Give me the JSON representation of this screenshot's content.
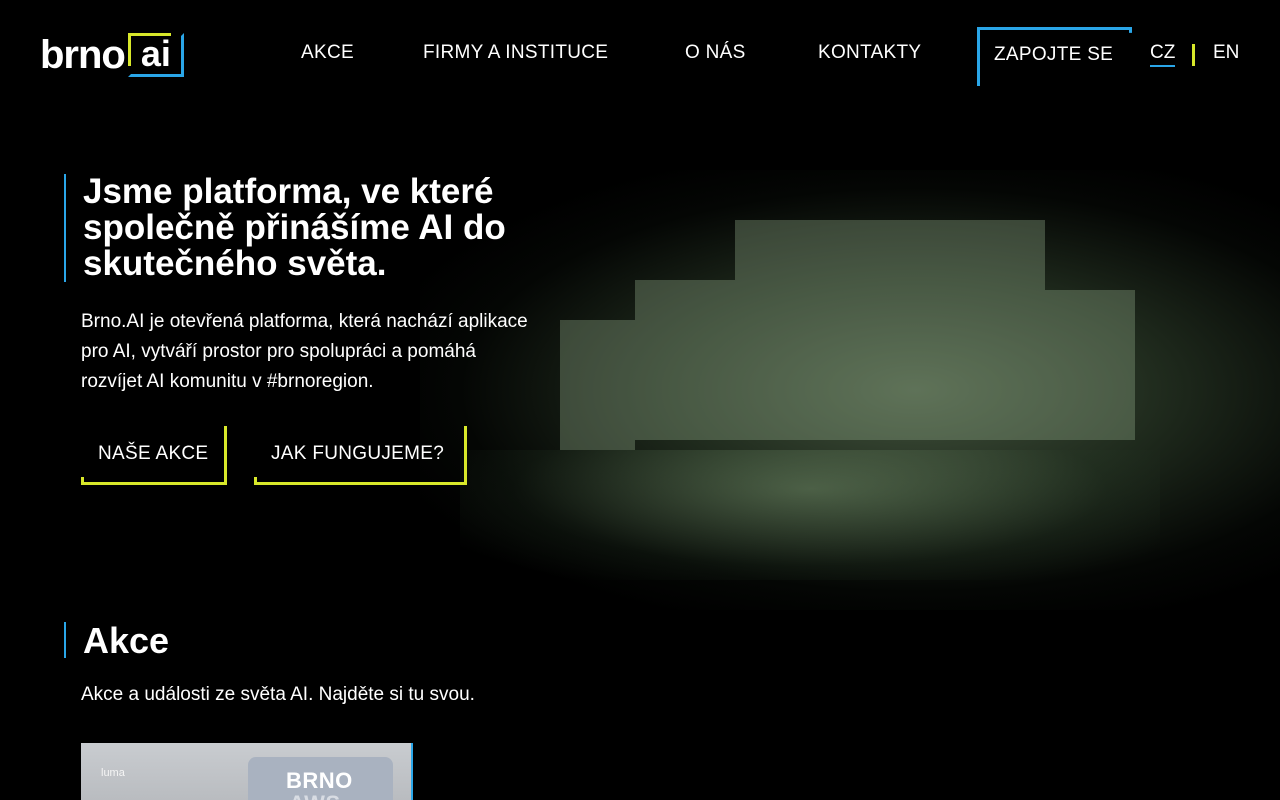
{
  "header": {
    "logo_text": "brno",
    "logo_box_text": "ai",
    "nav": [
      "AKCE",
      "FIRMY A INSTITUCE",
      "O NÁS",
      "KONTAKTY"
    ],
    "cta": "ZAPOJTE SE",
    "lang_active": "CZ",
    "lang_other": "EN"
  },
  "hero": {
    "title": "Jsme platforma, ve které společně přinášíme AI do skutečného světa.",
    "text": "Brno.AI je otevřená platforma, která nachází aplikace pro AI, vytváří prostor pro spolupráci a pomáhá rozvíjet AI komunitu v #brnoregion.",
    "buttons": [
      "NAŠE AKCE",
      "JAK FUNGUJEME?"
    ]
  },
  "events": {
    "title": "Akce",
    "subtitle": "Akce a události ze světa AI. Najděte si tu svou.",
    "card": {
      "brand": "luma",
      "poster_title": "BRNO",
      "poster_sub": "AWS"
    }
  },
  "colors": {
    "accent_blue": "#2aa6e8",
    "accent_yellow": "#d8e82a",
    "background": "#000000"
  }
}
